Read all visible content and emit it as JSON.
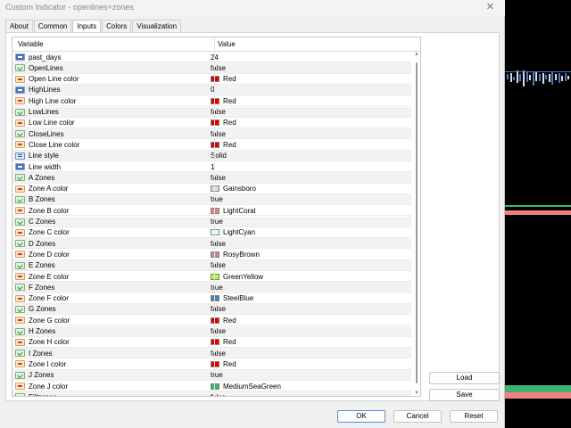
{
  "window": {
    "title": "Custom Indicator - openlines+zones",
    "close_glyph": "✕"
  },
  "tabs": [
    {
      "label": "About",
      "active": false
    },
    {
      "label": "Common",
      "active": false
    },
    {
      "label": "Inputs",
      "active": true
    },
    {
      "label": "Colors",
      "active": false
    },
    {
      "label": "Visualization",
      "active": false
    }
  ],
  "grid": {
    "columns": [
      "Variable",
      "Value"
    ],
    "rows": [
      {
        "icon": "num",
        "variable": "past_days",
        "value": "24"
      },
      {
        "icon": "bool",
        "variable": "OpenLines",
        "value": "false"
      },
      {
        "icon": "color",
        "variable": "Open Line color",
        "value": "Red",
        "color": "#e00000"
      },
      {
        "icon": "num",
        "variable": "HighLines",
        "value": "0"
      },
      {
        "icon": "color",
        "variable": "High Line color",
        "value": "Red",
        "color": "#e00000"
      },
      {
        "icon": "bool",
        "variable": "LowLines",
        "value": "false"
      },
      {
        "icon": "color",
        "variable": "Low Line color",
        "value": "Red",
        "color": "#e00000"
      },
      {
        "icon": "bool",
        "variable": "CloseLines",
        "value": "false"
      },
      {
        "icon": "color",
        "variable": "Close Line color",
        "value": "Red",
        "color": "#e00000"
      },
      {
        "icon": "enum",
        "variable": "Line style",
        "value": "Solid"
      },
      {
        "icon": "num",
        "variable": "Line width",
        "value": "1"
      },
      {
        "icon": "bool",
        "variable": "A Zones",
        "value": "false"
      },
      {
        "icon": "color",
        "variable": "Zone A color",
        "value": "Gainsboro",
        "color": "#dcdcdc"
      },
      {
        "icon": "bool",
        "variable": "B Zones",
        "value": "true"
      },
      {
        "icon": "color",
        "variable": "Zone B color",
        "value": "LightCoral",
        "color": "#f08080"
      },
      {
        "icon": "bool",
        "variable": "C Zones",
        "value": "true"
      },
      {
        "icon": "color",
        "variable": "Zone C color",
        "value": "LightCyan",
        "color": "#e0ffff"
      },
      {
        "icon": "bool",
        "variable": "D Zones",
        "value": "false"
      },
      {
        "icon": "color",
        "variable": "Zone D color",
        "value": "RosyBrown",
        "color": "#bc8f8f"
      },
      {
        "icon": "bool",
        "variable": "E Zones",
        "value": "false"
      },
      {
        "icon": "color",
        "variable": "Zone E color",
        "value": "GreenYellow",
        "color": "#adff2f"
      },
      {
        "icon": "bool",
        "variable": "F Zones",
        "value": "true"
      },
      {
        "icon": "color",
        "variable": "Zone F color",
        "value": "SteelBlue",
        "color": "#4682b4"
      },
      {
        "icon": "bool",
        "variable": "G Zones",
        "value": "false"
      },
      {
        "icon": "color",
        "variable": "Zone G color",
        "value": "Red",
        "color": "#e00000"
      },
      {
        "icon": "bool",
        "variable": "H Zones",
        "value": "false"
      },
      {
        "icon": "color",
        "variable": "Zone H color",
        "value": "Red",
        "color": "#e00000"
      },
      {
        "icon": "bool",
        "variable": "I Zones",
        "value": "false"
      },
      {
        "icon": "color",
        "variable": "Zone I color",
        "value": "Red",
        "color": "#e00000"
      },
      {
        "icon": "bool",
        "variable": "J Zones",
        "value": "true"
      },
      {
        "icon": "color",
        "variable": "Zone J color",
        "value": "MediumSeaGreen",
        "color": "#3cb371"
      },
      {
        "icon": "bool",
        "variable": "Fillzones",
        "value": "false"
      }
    ]
  },
  "side_buttons": {
    "load": "Load",
    "save": "Save"
  },
  "footer": {
    "ok": "OK",
    "cancel": "Cancel",
    "reset": "Reset"
  },
  "chart_colors": {
    "band_red": "#f08080",
    "band_green": "#3cb371",
    "bar_blue": "#4a79c6",
    "bar_white": "#dcdcdc"
  }
}
